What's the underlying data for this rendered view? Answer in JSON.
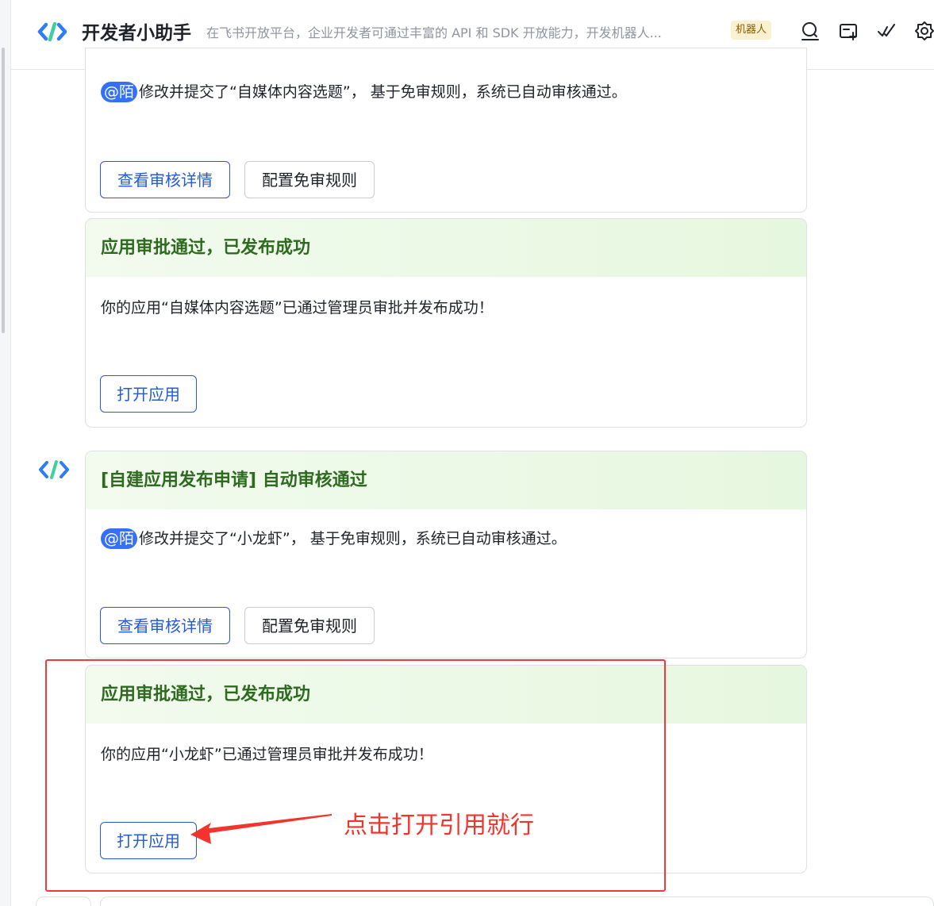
{
  "header": {
    "title": "开发者小助手",
    "description": "在飞书开放平台，企业开发者可通过丰富的 API 和 SDK 开放能力，开发机器人...",
    "tag": "机器人"
  },
  "cards": [
    {
      "body": "修改并提交了“自媒体内容选题”， 基于免审规则，系统已自动审核通过。",
      "mention": "@陌",
      "buttons": [
        "查看审核详情",
        "配置免审规则"
      ]
    },
    {
      "title": "应用审批通过，已发布成功",
      "body": "你的应用“自媒体内容选题”已通过管理员审批并发布成功！",
      "buttons": [
        "打开应用"
      ]
    },
    {
      "title": "[自建应用发布申请] 自动审核通过",
      "mention": "@陌",
      "body": "修改并提交了“小龙虾”， 基于免审规则，系统已自动审核通过。",
      "buttons": [
        "查看审核详情",
        "配置免审规则"
      ]
    },
    {
      "title": "应用审批通过，已发布成功",
      "body": "你的应用“小龙虾”已通过管理员审批并发布成功！",
      "buttons": [
        "打开应用"
      ]
    }
  ],
  "annotation": {
    "text": "点击打开引用就行"
  },
  "colors": {
    "primary": "#245bdb",
    "card_header_text": "#2e6a1f",
    "annotation_red": "#f2352c",
    "mention_bg": "#3370ff"
  },
  "icons": [
    "logo-icon",
    "search-icon",
    "create-group-icon",
    "done-icon",
    "settings-icon"
  ]
}
